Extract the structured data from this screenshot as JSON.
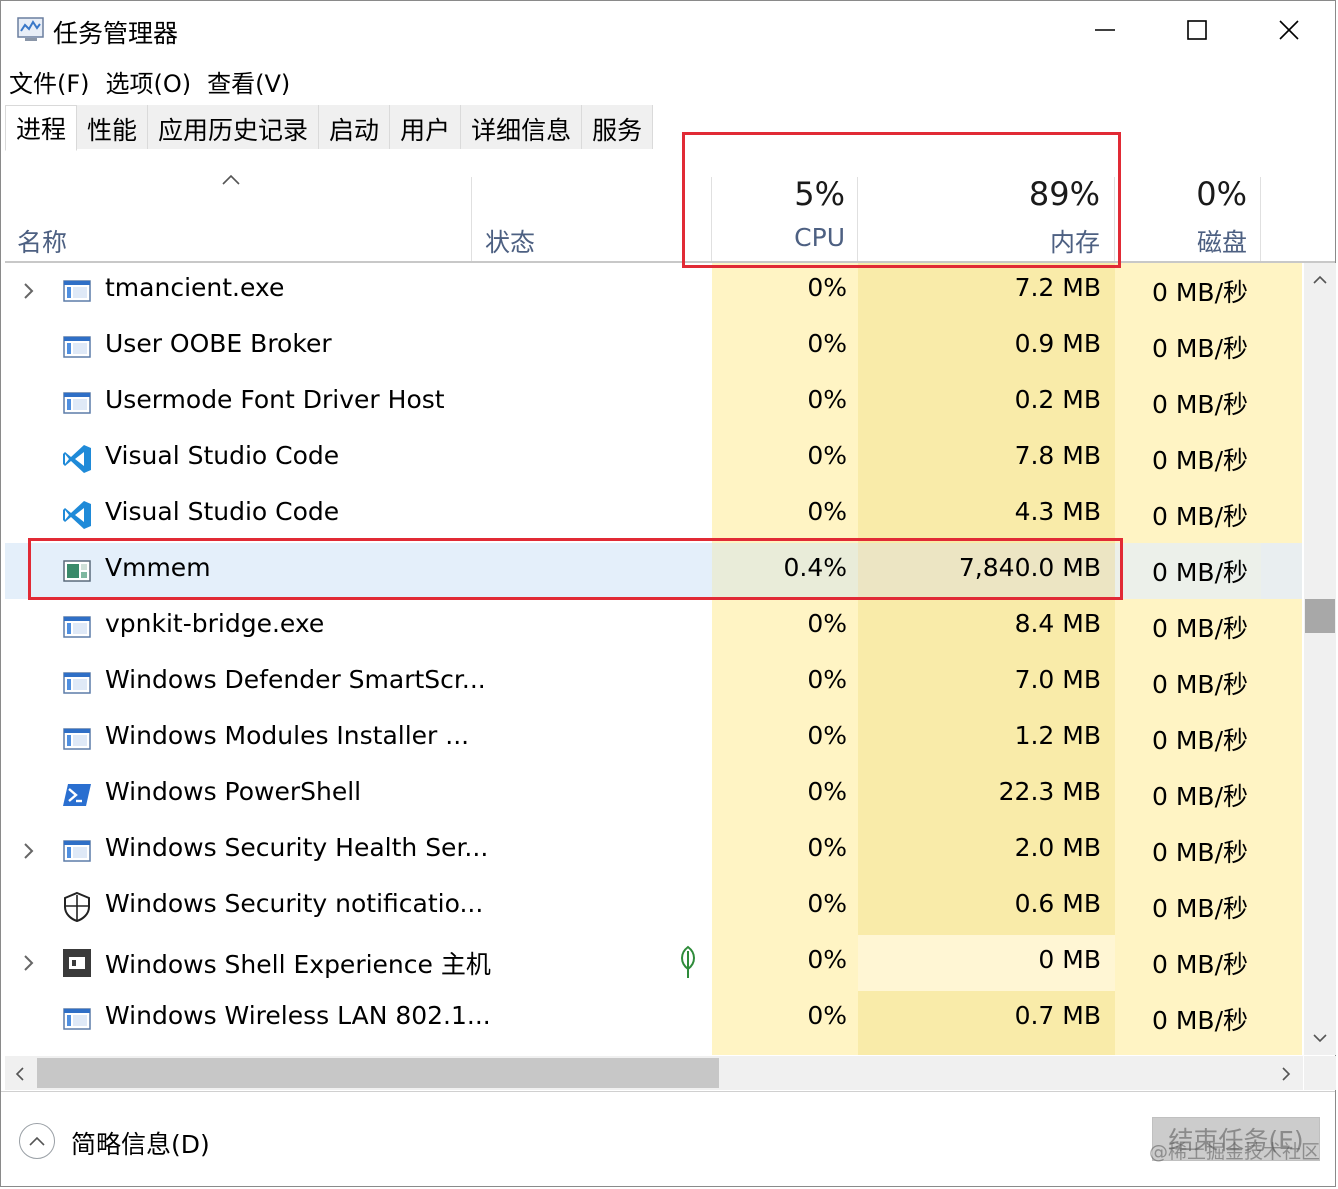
{
  "window": {
    "title": "任务管理器",
    "controls": {
      "minimize": "minimize",
      "maximize": "maximize",
      "close": "close"
    }
  },
  "menu": [
    "文件(F)",
    "选项(O)",
    "查看(V)"
  ],
  "tabs": [
    "进程",
    "性能",
    "应用历史记录",
    "启动",
    "用户",
    "详细信息",
    "服务"
  ],
  "active_tab": "进程",
  "columns": {
    "name": "名称",
    "status": "状态",
    "cpu": {
      "pct": "5%",
      "label": "CPU"
    },
    "memory": {
      "pct": "89%",
      "label": "内存"
    },
    "disk": {
      "pct": "0%",
      "label": "磁盘"
    }
  },
  "processes": [
    {
      "name": "tmancient.exe",
      "icon": "app-window-icon",
      "expandable": true,
      "cpu": "0%",
      "mem": "7.2 MB",
      "disk": "0 MB/秒"
    },
    {
      "name": "User OOBE Broker",
      "icon": "app-window-icon",
      "expandable": false,
      "cpu": "0%",
      "mem": "0.9 MB",
      "disk": "0 MB/秒"
    },
    {
      "name": "Usermode Font Driver Host",
      "icon": "app-window-icon",
      "expandable": false,
      "cpu": "0%",
      "mem": "0.2 MB",
      "disk": "0 MB/秒"
    },
    {
      "name": "Visual Studio Code",
      "icon": "vscode-icon",
      "expandable": false,
      "cpu": "0%",
      "mem": "7.8 MB",
      "disk": "0 MB/秒"
    },
    {
      "name": "Visual Studio Code",
      "icon": "vscode-icon",
      "expandable": false,
      "cpu": "0%",
      "mem": "4.3 MB",
      "disk": "0 MB/秒"
    },
    {
      "name": "Vmmem",
      "icon": "vmmem-icon",
      "expandable": false,
      "cpu": "0.4%",
      "mem": "7,840.0 MB",
      "disk": "0 MB/秒",
      "selected": true
    },
    {
      "name": "vpnkit-bridge.exe",
      "icon": "app-window-icon",
      "expandable": false,
      "cpu": "0%",
      "mem": "8.4 MB",
      "disk": "0 MB/秒"
    },
    {
      "name": "Windows Defender SmartScr...",
      "icon": "app-window-icon",
      "expandable": false,
      "cpu": "0%",
      "mem": "7.0 MB",
      "disk": "0 MB/秒"
    },
    {
      "name": "Windows Modules Installer ...",
      "icon": "app-window-icon",
      "expandable": false,
      "cpu": "0%",
      "mem": "1.2 MB",
      "disk": "0 MB/秒"
    },
    {
      "name": "Windows PowerShell",
      "icon": "powershell-icon",
      "expandable": false,
      "cpu": "0%",
      "mem": "22.3 MB",
      "disk": "0 MB/秒"
    },
    {
      "name": "Windows Security Health Ser...",
      "icon": "app-window-icon",
      "expandable": true,
      "cpu": "0%",
      "mem": "2.0 MB",
      "disk": "0 MB/秒"
    },
    {
      "name": "Windows Security notificatio...",
      "icon": "security-shield-icon",
      "expandable": false,
      "cpu": "0%",
      "mem": "0.6 MB",
      "disk": "0 MB/秒"
    },
    {
      "name": "Windows Shell Experience 主机",
      "icon": "shell-experience-icon",
      "expandable": true,
      "cpu": "0%",
      "mem": "0 MB",
      "disk": "0 MB/秒",
      "status_icon": "leaf-suspended-icon"
    },
    {
      "name": "Windows Wireless LAN 802.1...",
      "icon": "app-window-icon",
      "expandable": false,
      "cpu": "0%",
      "mem": "0.7 MB",
      "disk": "0 MB/秒"
    }
  ],
  "footer": {
    "fewer_details": "简略信息(D)",
    "end_task": "结束任务(E)",
    "watermark": "@稀土掘金技术社区"
  },
  "colors": {
    "highlight_box": "#e12a35",
    "heat_light": "#fff4c4",
    "heat_medium": "#f9eba9",
    "selection": "#e4effa"
  }
}
